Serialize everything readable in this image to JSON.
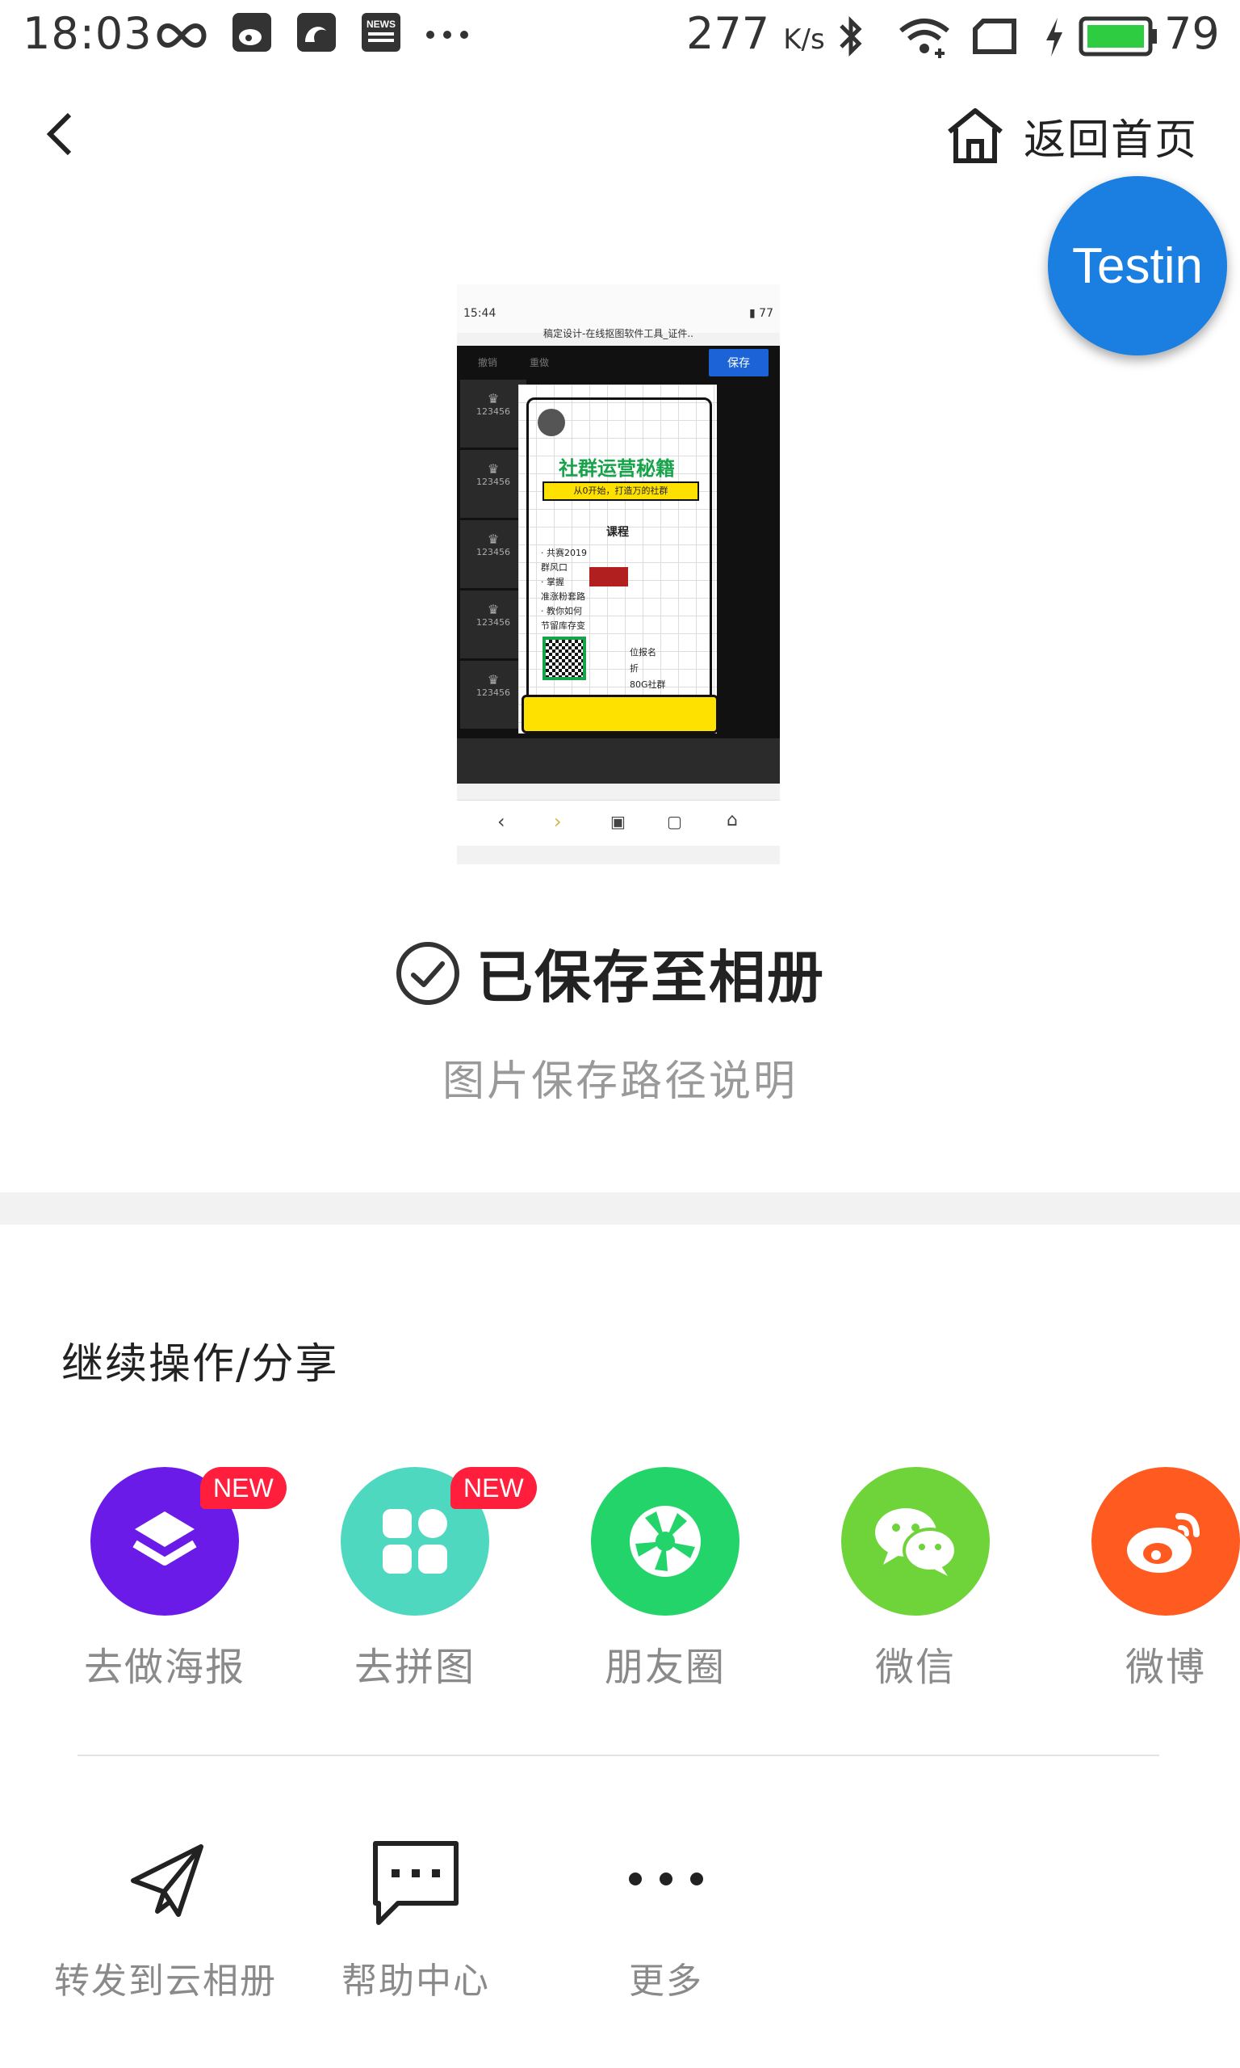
{
  "status_bar": {
    "time": "18:03",
    "net_speed": "277",
    "net_unit": "K/s",
    "battery": "79",
    "icons": [
      "infinity-icon",
      "weibo-notification-icon",
      "uc-browser-icon",
      "news-icon",
      "more-dots-icon",
      "bluetooth-icon",
      "wifi-icon",
      "screen-icon",
      "charging-icon",
      "battery-icon"
    ]
  },
  "nav": {
    "back_icon": "chevron-left-icon",
    "home_label": "返回首页"
  },
  "overlay": {
    "testin_label": "Testin"
  },
  "preview": {
    "status_time": "15:44",
    "status_battery": "77",
    "page_title": "稿定设计-在线抠图软件工具_证件..",
    "toolbar_undo": "撤销",
    "toolbar_redo": "重做",
    "save_label": "保存",
    "thumb_label": "123456",
    "poster_heading": "社群运营秘籍",
    "poster_sub": "从0开始，打造万的社群",
    "poster_section": "课程",
    "poster_lines": [
      "· 共赛2019",
      "群风口",
      "· 掌握",
      "准涨粉套路",
      "· 教你如何",
      "节留库存变"
    ],
    "poster_right": [
      "位报名",
      "折",
      "80G社群"
    ]
  },
  "saved": {
    "title": "已保存至相册",
    "path_hint": "图片保存路径说明"
  },
  "share_section": {
    "title": "继续操作/分享",
    "items": [
      {
        "label": "去做海报",
        "badge": "NEW",
        "color": "#6a1be8"
      },
      {
        "label": "去拼图",
        "badge": "NEW",
        "color": "#4fd8c0"
      },
      {
        "label": "朋友圈",
        "color": "#22d46a"
      },
      {
        "label": "微信",
        "color": "#6fd33a"
      },
      {
        "label": "微博",
        "color": "#ff5a1f"
      }
    ]
  },
  "tools": [
    {
      "label": "转发到云相册",
      "icon": "paper-plane-icon"
    },
    {
      "label": "帮助中心",
      "icon": "chat-bubble-icon"
    },
    {
      "label": "更多",
      "icon": "more-dots-icon"
    }
  ]
}
